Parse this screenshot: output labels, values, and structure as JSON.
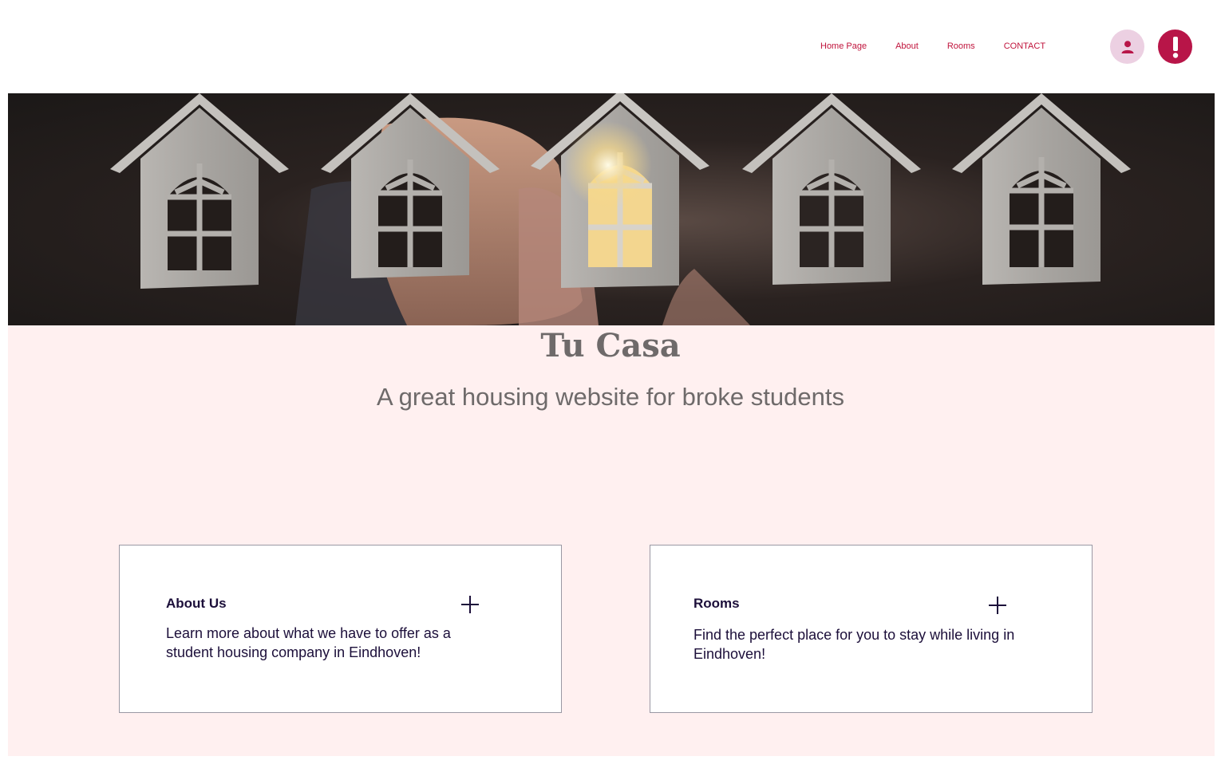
{
  "header": {
    "nav": [
      {
        "label": "Home Page"
      },
      {
        "label": "About"
      },
      {
        "label": "Rooms"
      },
      {
        "label": "CONTACT"
      }
    ],
    "user_icon": "user-icon",
    "alert_icon": "exclamation-icon"
  },
  "hero": {
    "image": "wooden-house-models-hand-photo",
    "title": "Tu Casa",
    "subtitle": "A great housing website for broke students"
  },
  "cards": [
    {
      "title": "About Us",
      "text": "Learn more about what we have to offer as a student housing company in Eindhoven!",
      "icon": "plus-icon"
    },
    {
      "title": "Rooms",
      "text": "Find the perfect place for you to stay while living in Eindhoven!",
      "icon": "plus-icon"
    }
  ],
  "colors": {
    "accent": "#c0143c",
    "alert_button": "#b81548",
    "user_button": "#ecd0e2",
    "section_background": "#fff0f0",
    "card_text": "#1c0f3a",
    "heading_text": "#6e6a6a"
  }
}
